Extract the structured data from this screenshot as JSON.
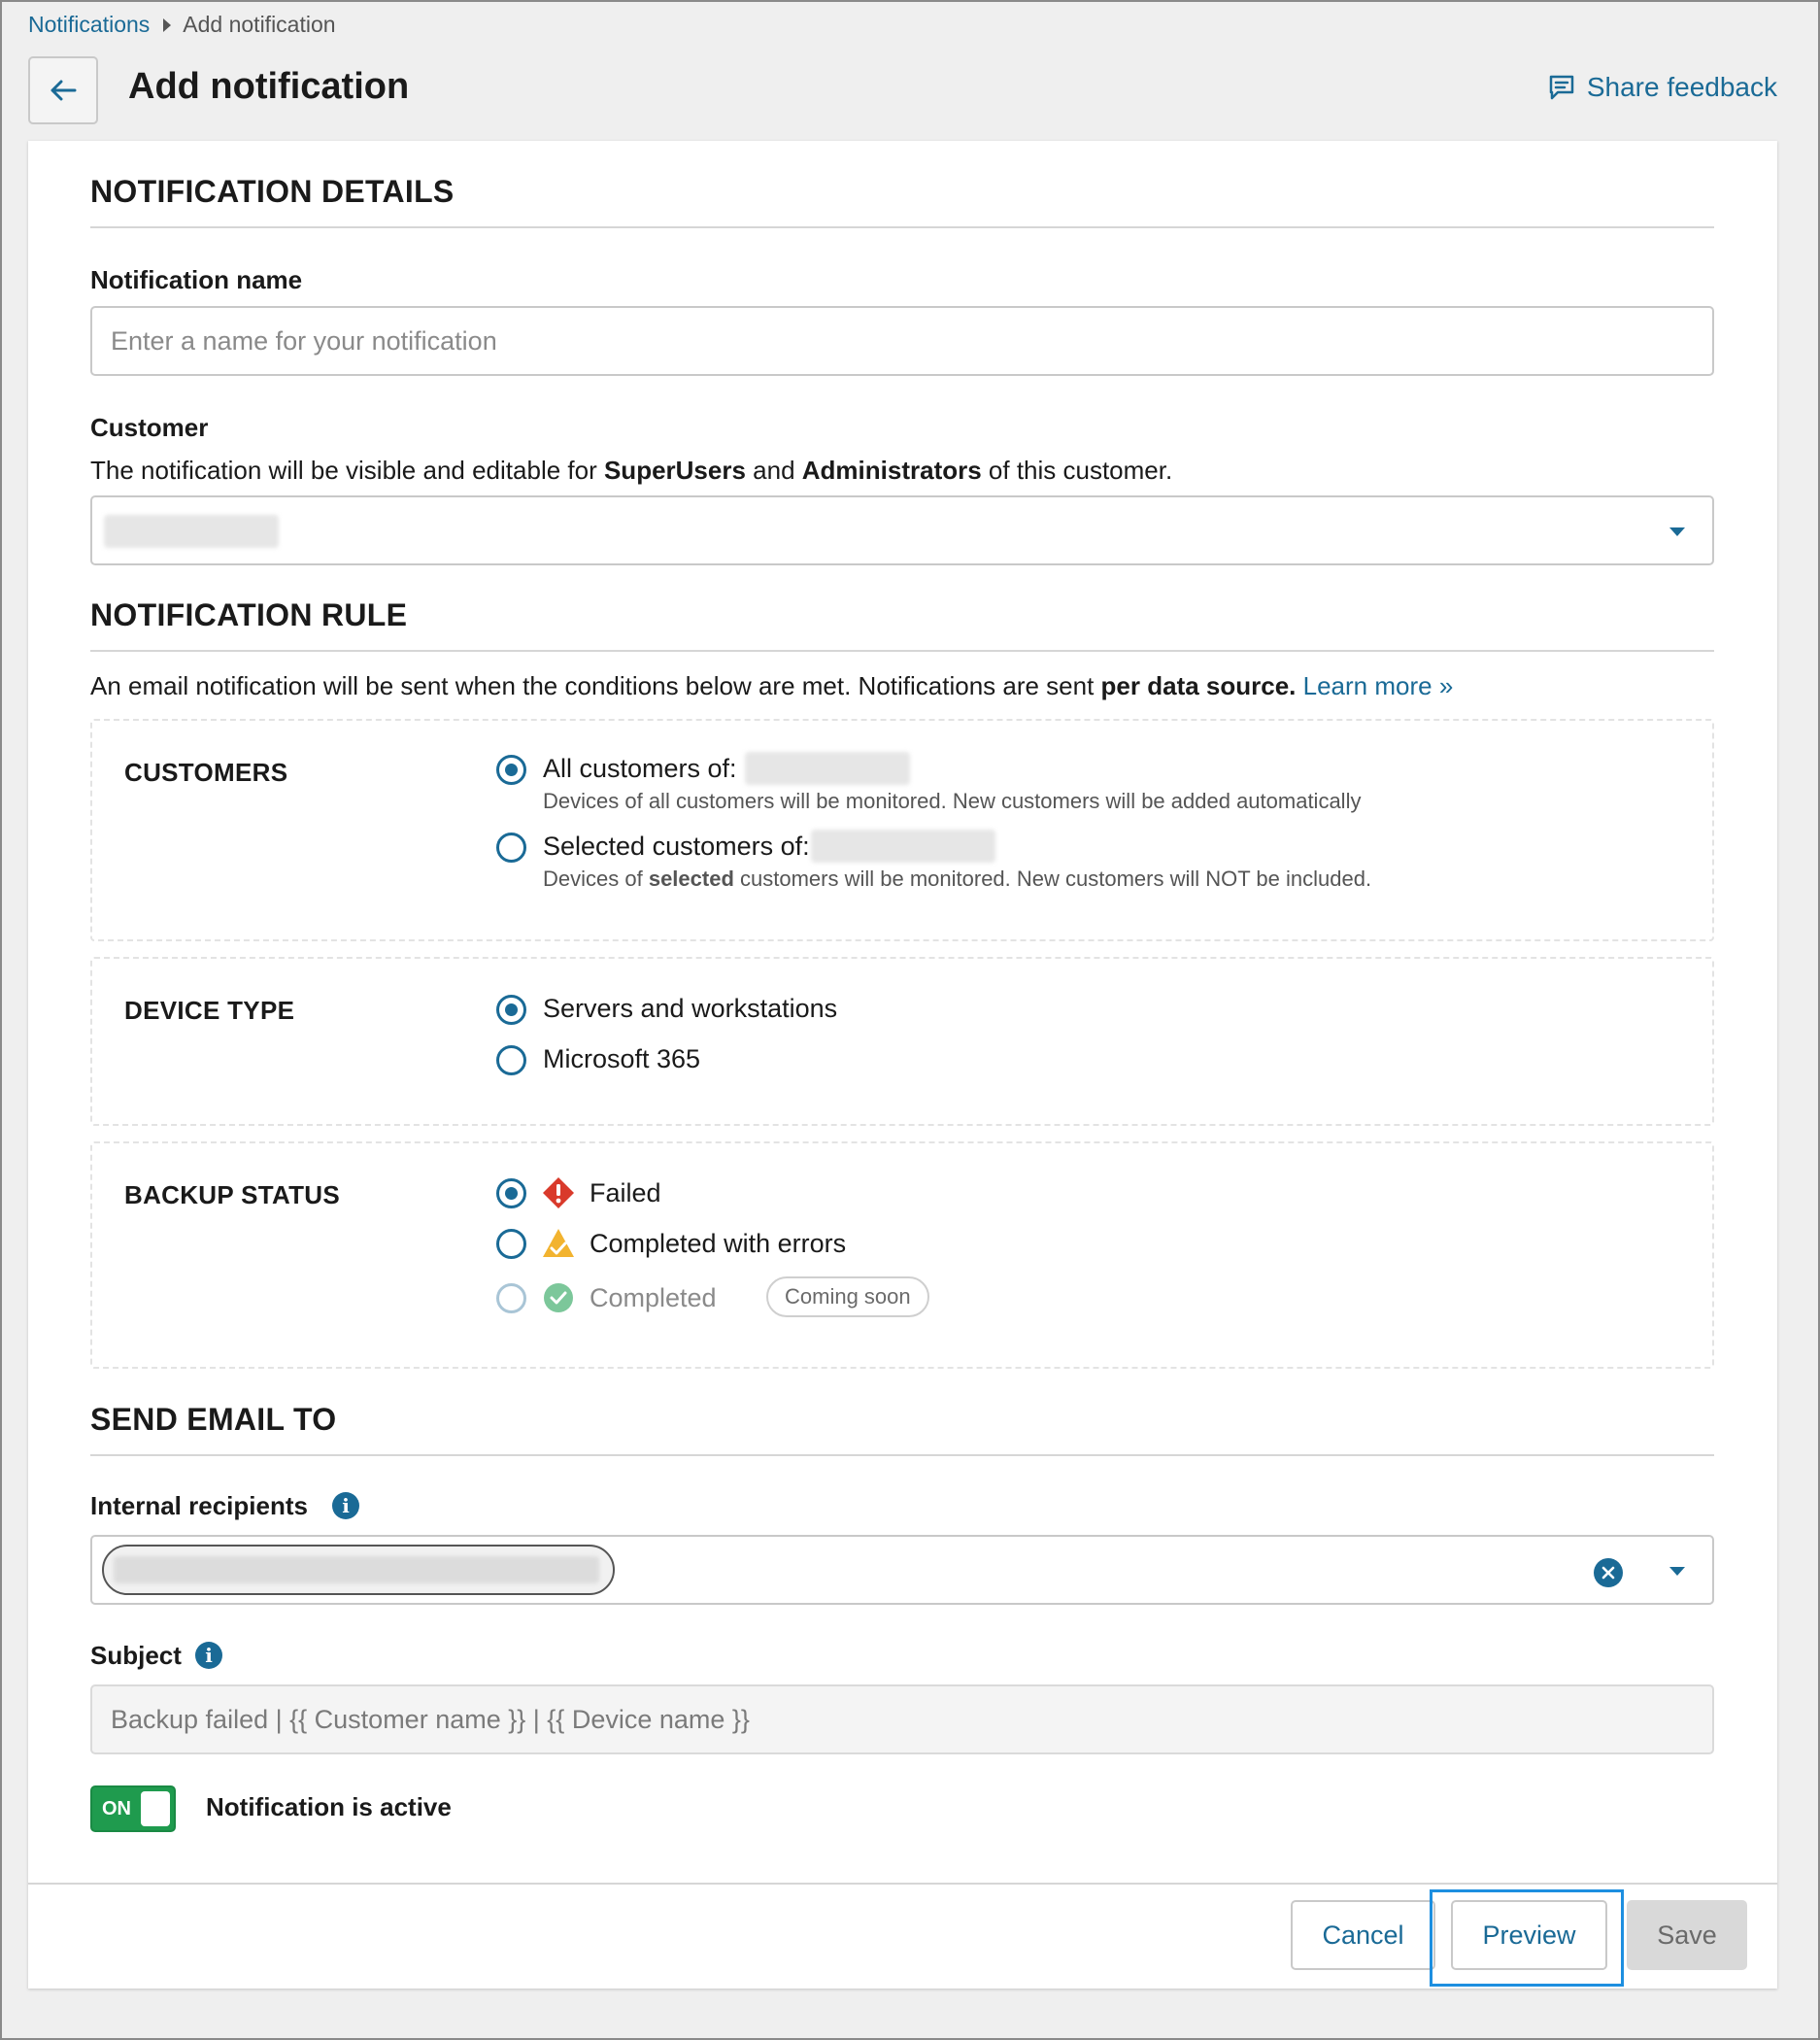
{
  "breadcrumb": {
    "parent": "Notifications",
    "current": "Add notification"
  },
  "header": {
    "title": "Add notification",
    "feedback_label": "Share feedback"
  },
  "details": {
    "section_title": "NOTIFICATION DETAILS",
    "name_label": "Notification name",
    "name_placeholder": "Enter a name for your notification",
    "name_value": "",
    "customer_label": "Customer",
    "customer_desc_prefix": "The notification will be visible and editable for ",
    "customer_desc_role1": "SuperUsers",
    "customer_desc_and": " and ",
    "customer_desc_role2": "Administrators",
    "customer_desc_suffix": " of this customer."
  },
  "rule": {
    "section_title": "NOTIFICATION RULE",
    "desc_prefix": "An email notification will be sent when the conditions below are met. Notifications are sent ",
    "desc_bold": "per data source.",
    "learn_more": "Learn more »",
    "customers": {
      "label": "CUSTOMERS",
      "options": [
        {
          "text": "All customers of:",
          "sub": "Devices of all customers will be monitored. New customers will be added automatically",
          "checked": true
        },
        {
          "text": "Selected customers of:",
          "sub_prefix": "Devices of ",
          "sub_bold": "selected",
          "sub_suffix": " customers will be monitored. New customers will NOT be included.",
          "checked": false
        }
      ]
    },
    "device_type": {
      "label": "DEVICE TYPE",
      "options": [
        {
          "text": "Servers and workstations",
          "checked": true
        },
        {
          "text": "Microsoft 365",
          "checked": false
        }
      ]
    },
    "backup_status": {
      "label": "BACKUP STATUS",
      "options": [
        {
          "text": "Failed",
          "icon": "failed-diamond-icon",
          "color": "#d93a2b",
          "checked": true
        },
        {
          "text": "Completed with errors",
          "icon": "warning-triangle-icon",
          "color": "#f2b32f",
          "checked": false
        },
        {
          "text": "Completed",
          "icon": "check-circle-icon",
          "color": "#7cc79a",
          "checked": false,
          "disabled": true,
          "badge": "Coming soon"
        }
      ]
    }
  },
  "send": {
    "section_title": "SEND EMAIL TO",
    "recipients_label": "Internal recipients",
    "subject_label": "Subject",
    "subject_value": "Backup failed | {{ Customer name }} | {{ Device name }}",
    "toggle_label": "ON",
    "active_label": "Notification is active"
  },
  "footer": {
    "cancel": "Cancel",
    "preview": "Preview",
    "save": "Save"
  },
  "colors": {
    "accent": "#1a6a96",
    "toggle_on": "#1f9b4e",
    "focus": "#1d8fe0"
  }
}
